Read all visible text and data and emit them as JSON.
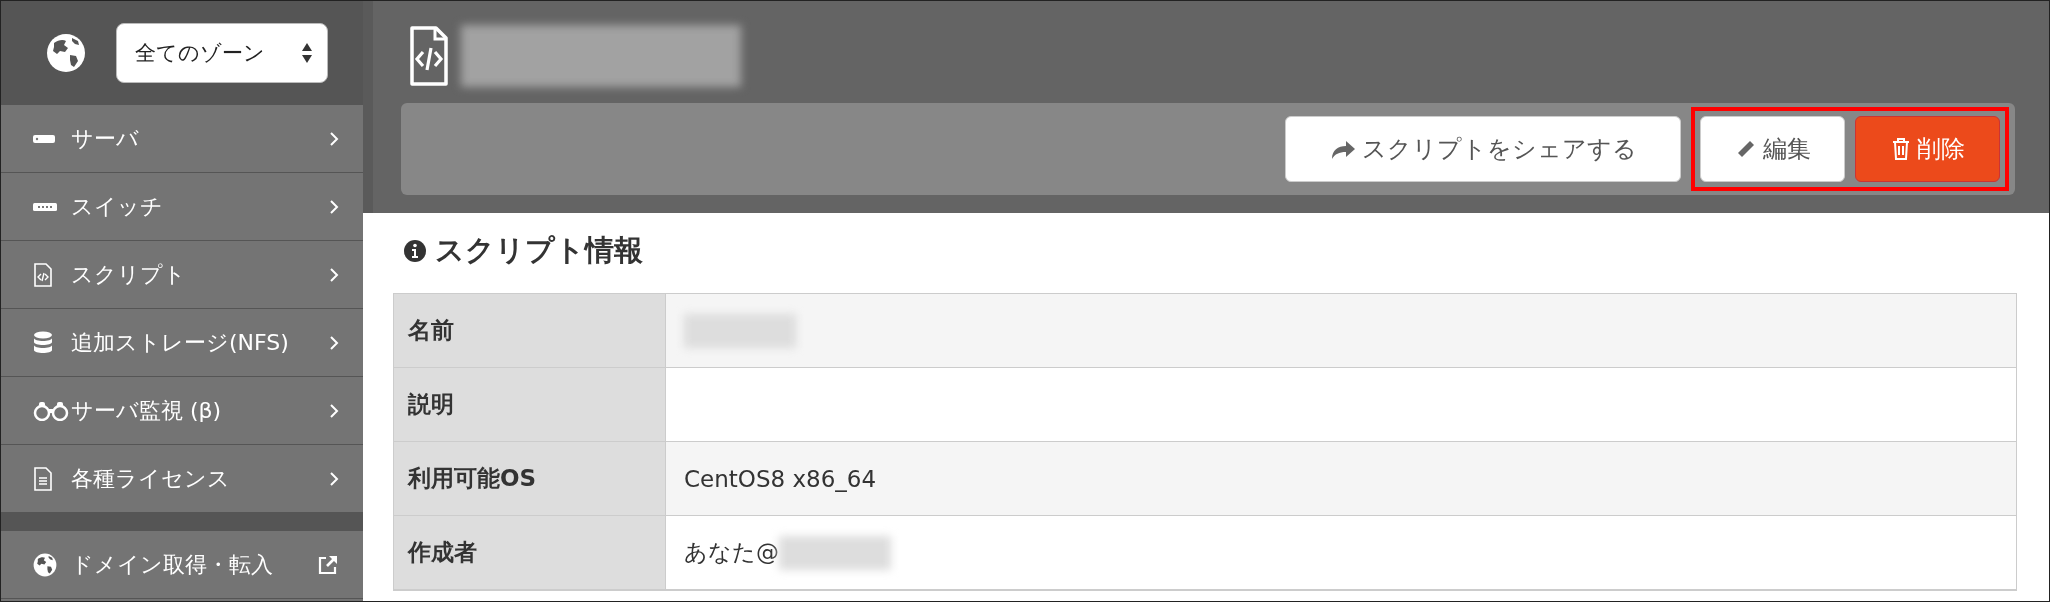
{
  "zone_select": {
    "value": "全てのゾーン"
  },
  "sidebar": {
    "items": [
      {
        "label": "サーバ"
      },
      {
        "label": "スイッチ"
      },
      {
        "label": "スクリプト"
      },
      {
        "label": "追加ストレージ(NFS)"
      },
      {
        "label": "サーバ監視 (β)"
      },
      {
        "label": "各種ライセンス"
      }
    ],
    "external_links": [
      {
        "label": "ドメイン取得・転入"
      }
    ]
  },
  "header": {
    "title_redacted": true
  },
  "toolbar": {
    "buttons": [
      {
        "label": "スクリプトをシェアする",
        "kind": "share",
        "highlighted": false
      },
      {
        "label": "編集",
        "kind": "edit",
        "highlighted": true
      },
      {
        "label": "削除",
        "kind": "delete",
        "highlighted": true
      }
    ]
  },
  "section": {
    "title": "スクリプト情報"
  },
  "table": {
    "rows": [
      {
        "label": "名前",
        "redacted": true
      },
      {
        "label": "説明",
        "redacted": false
      },
      {
        "label": "利用可能OS",
        "value": "CentOS8 x86_64",
        "redacted": false
      },
      {
        "label": "作成者",
        "value": "あなた@",
        "redacted": true
      }
    ]
  }
}
